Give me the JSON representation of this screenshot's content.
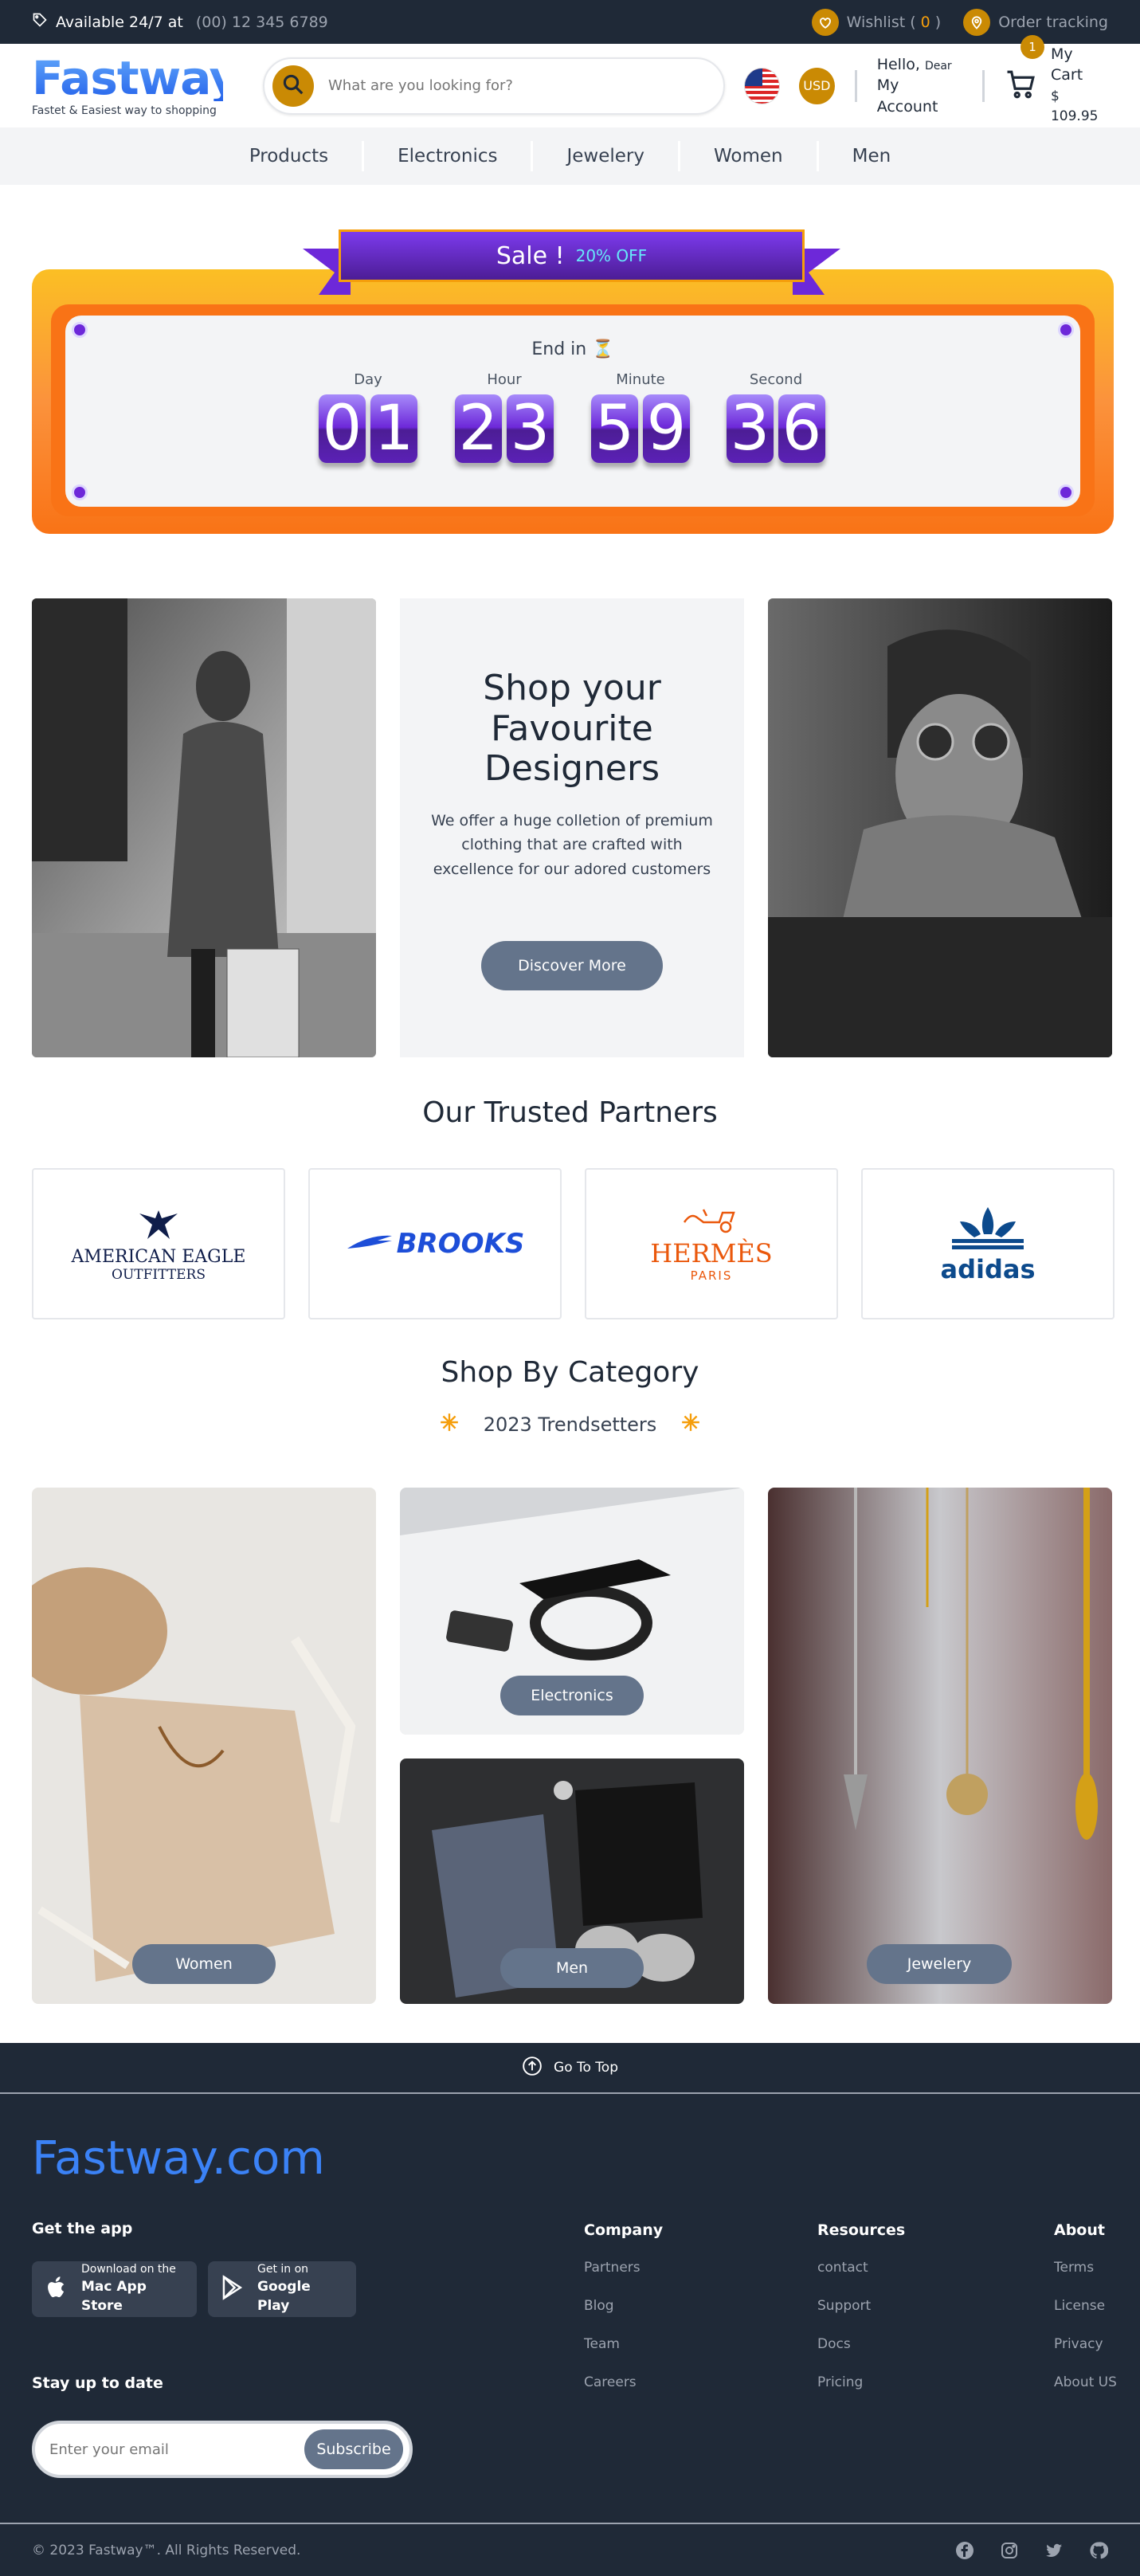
{
  "topbar": {
    "available": "Available 24/7 at",
    "phone": "(00) 12 345 6789",
    "wishlist": "Wishlist",
    "wishlist_count": "0",
    "tracking": "Order tracking"
  },
  "header": {
    "logo": "Fastway",
    "tagline": "Fastet & Easiest way to shopping",
    "search_placeholder": "What are you looking for?",
    "currency": "USD",
    "hello": "Hello,",
    "dear": "Dear",
    "account": "My Account",
    "cart_label": "My Cart",
    "cart_total": "$ 109.95",
    "cart_count": "1"
  },
  "nav": [
    "Products",
    "Electronics",
    "Jewelery",
    "Women",
    "Men"
  ],
  "sale": {
    "title": "Sale !",
    "off": "20% OFF",
    "end_in": "End in ⏳",
    "countdown": [
      {
        "label": "Day",
        "value": "01"
      },
      {
        "label": "Hour",
        "value": "23"
      },
      {
        "label": "Minute",
        "value": "59"
      },
      {
        "label": "Second",
        "value": "36"
      }
    ]
  },
  "featured": {
    "title": "Shop your Favourite Designers",
    "text": "We offer a huge colletion of premium clothing that are crafted with excellence for our adored customers",
    "button": "Discover More"
  },
  "partners": {
    "title": "Our Trusted Partners",
    "items": [
      "AMERICAN EAGLE",
      "OUTFITTERS",
      "BROOKS",
      "HERMÈS",
      "PARIS",
      "adidas"
    ]
  },
  "category": {
    "title": "Shop By Category",
    "subtitle": "2023 Trendsetters",
    "tiles": {
      "women": "Women",
      "electronics": "Electronics",
      "men": "Men",
      "jewelery": "Jewelery"
    }
  },
  "footer": {
    "go_top": "Go To Top",
    "brand": "Fastway.com",
    "get_app": "Get the app",
    "apple_small": "Download on the",
    "apple_big": "Mac App Store",
    "google_small": "Get in on",
    "google_big": "Google Play",
    "stay": "Stay up to date",
    "email_placeholder": "Enter your email",
    "subscribe": "Subscribe",
    "columns": [
      {
        "title": "Company",
        "links": [
          "Partners",
          "Blog",
          "Team",
          "Careers"
        ]
      },
      {
        "title": "Resources",
        "links": [
          "contact",
          "Support",
          "Docs",
          "Pricing"
        ]
      },
      {
        "title": "About",
        "links": [
          "Terms",
          "License",
          "Privacy",
          "About US"
        ]
      }
    ],
    "copyright": "© 2023 Fastway™. All Rights Reserved."
  },
  "colors": {
    "dark": "#1f2937",
    "gold": "#ca8a04",
    "blue": "#3b82f6",
    "purple": "#6d28d9",
    "slate": "#64748b",
    "orange": "#f97316"
  }
}
